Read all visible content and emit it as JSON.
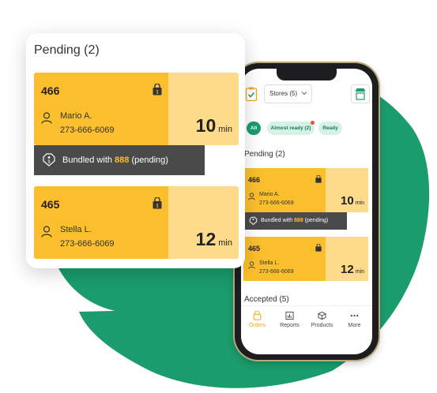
{
  "colors": {
    "brand_green": "#1a9c6c",
    "order_yellow": "#fbbf2d",
    "order_light_yellow": "#fedb8a",
    "bundle_dark": "#4a4a4a",
    "active_tab": "#f2a81d"
  },
  "popup": {
    "title": "Pending (2)",
    "orders": [
      {
        "number": "466",
        "customer": "Mario A.",
        "phone": "273-666-6069",
        "minutes": "10",
        "unit": "min"
      },
      {
        "number": "465",
        "customer": "Stella L.",
        "phone": "273-666-6069",
        "minutes": "12",
        "unit": "min"
      }
    ],
    "bundle": {
      "prefix": "Bundled with ",
      "order": "888",
      "suffix": " (pending)"
    }
  },
  "phone": {
    "stores_select": "Stores (5)",
    "filters": [
      {
        "label": "All",
        "active": true
      },
      {
        "label": "Almost ready (2)",
        "active": false,
        "has_alert": true
      },
      {
        "label": "Ready",
        "active": false
      }
    ],
    "pending_title": "Pending (2)",
    "orders": [
      {
        "number": "466",
        "customer": "Mario A.",
        "phone": "273-666-6069",
        "minutes": "10",
        "unit": "min"
      },
      {
        "number": "465",
        "customer": "Stella L.",
        "phone": "273-666-6069",
        "minutes": "12",
        "unit": "min"
      }
    ],
    "bundle": {
      "prefix": "Bundled with ",
      "order": "888",
      "suffix": " (pending)"
    },
    "accepted_title": "Accepted (5)",
    "tabs": [
      {
        "label": "Orders",
        "icon": "bag-icon",
        "active": true
      },
      {
        "label": "Reports",
        "icon": "bar-chart-icon",
        "active": false
      },
      {
        "label": "Products",
        "icon": "box-icon",
        "active": false
      },
      {
        "label": "More",
        "icon": "ellipsis-icon",
        "active": false
      }
    ]
  }
}
